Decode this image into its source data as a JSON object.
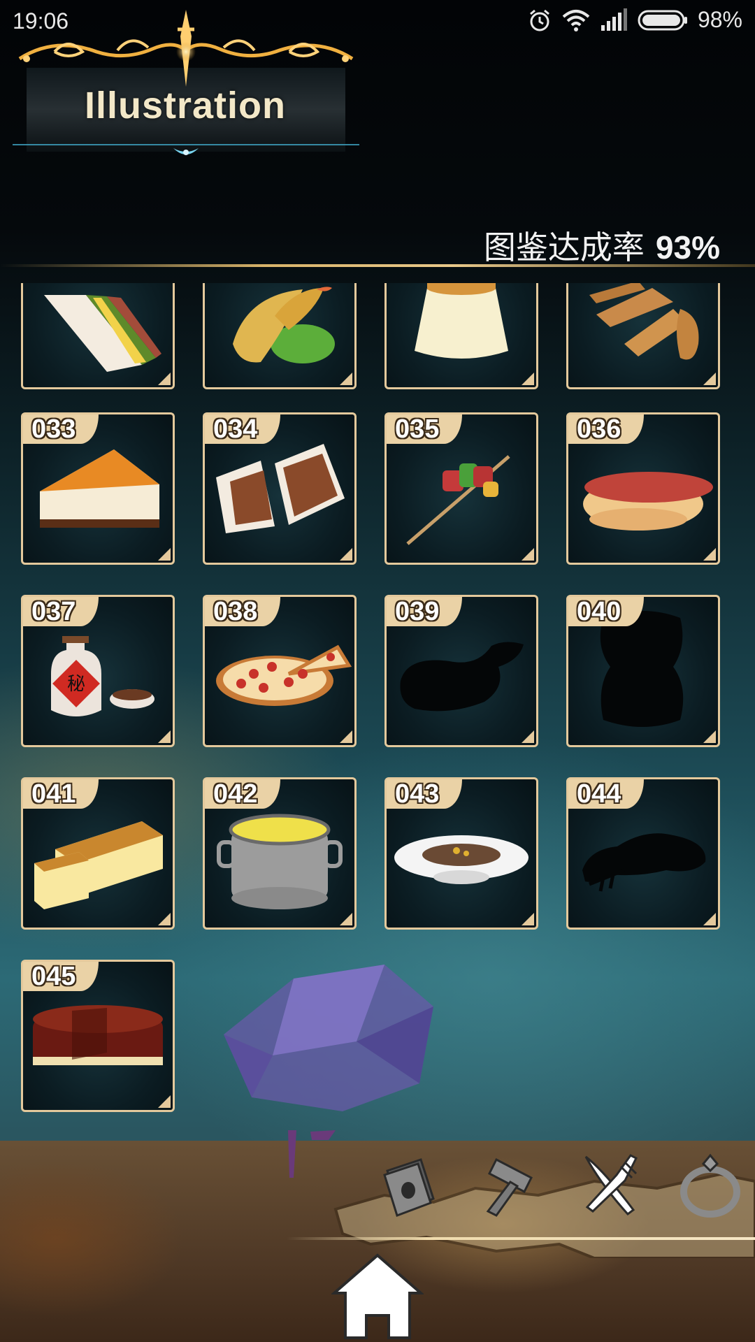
{
  "status_bar": {
    "time": "19:06",
    "battery_percent": "98%",
    "icons": [
      "alarm-icon",
      "wifi-icon",
      "signal-icon",
      "battery-icon"
    ]
  },
  "header": {
    "title": "Illustration",
    "completion_label": "图鉴达成率",
    "completion_value": "93%"
  },
  "grid": {
    "partial_row": [
      {
        "food": "sandwich",
        "silhouette": false
      },
      {
        "food": "fried-shrimp",
        "silhouette": false
      },
      {
        "food": "pudding",
        "silhouette": false
      },
      {
        "food": "potato-wedges",
        "silhouette": false
      }
    ],
    "items": [
      {
        "number": "033",
        "food": "cheesecake",
        "silhouette": false
      },
      {
        "number": "034",
        "food": "katsu-sandwich",
        "silhouette": false
      },
      {
        "number": "035",
        "food": "skewer",
        "silhouette": false
      },
      {
        "number": "036",
        "food": "hot-dog",
        "silhouette": false
      },
      {
        "number": "037",
        "food": "secret-sauce",
        "silhouette": false
      },
      {
        "number": "038",
        "food": "pizza",
        "silhouette": false
      },
      {
        "number": "039",
        "food": "unknown",
        "silhouette": true
      },
      {
        "number": "040",
        "food": "unknown",
        "silhouette": true
      },
      {
        "number": "041",
        "food": "castella",
        "silhouette": false
      },
      {
        "number": "042",
        "food": "soup-pot",
        "silhouette": false
      },
      {
        "number": "043",
        "food": "curry-plate",
        "silhouette": false
      },
      {
        "number": "044",
        "food": "unknown",
        "silhouette": true
      },
      {
        "number": "045",
        "food": "chocolate-cake",
        "silhouette": false
      }
    ],
    "secret_sauce_label": "秘"
  },
  "bottom_nav": {
    "items": [
      {
        "name": "book-icon",
        "active": false
      },
      {
        "name": "hammer-icon",
        "active": false
      },
      {
        "name": "fork-knife-icon",
        "active": true
      },
      {
        "name": "ring-icon",
        "active": false
      }
    ],
    "home": "home-icon"
  },
  "colors": {
    "card_border": "#e4c99c",
    "number_tab": "#ead2a6",
    "gold": "#d8b36a",
    "active_icon": "#ffffff",
    "inactive_icon": "#8a8a8a"
  }
}
